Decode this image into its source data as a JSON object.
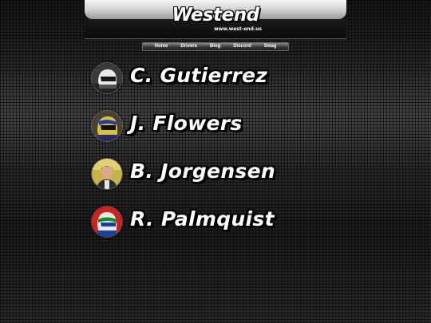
{
  "header": {
    "logo_text": "Westend",
    "logo_url": "www.west-end.us"
  },
  "nav": {
    "items": [
      {
        "label": "Home"
      },
      {
        "label": "Drivers"
      },
      {
        "label": "Blog"
      },
      {
        "label": "Discord"
      },
      {
        "label": "Swag"
      }
    ]
  },
  "drivers": [
    {
      "name": "C. Gutierrez",
      "avatar_icon": "driver-avatar-helmet-white"
    },
    {
      "name": "J. Flowers",
      "avatar_icon": "driver-avatar-helmet-yellow"
    },
    {
      "name": "B. Jorgensen",
      "avatar_icon": "driver-avatar-photo"
    },
    {
      "name": "R. Palmquist",
      "avatar_icon": "driver-avatar-helmet-red-blue"
    }
  ],
  "colors": {
    "background": "#2a2a2a",
    "text": "#ffffff",
    "outline": "#000000"
  }
}
